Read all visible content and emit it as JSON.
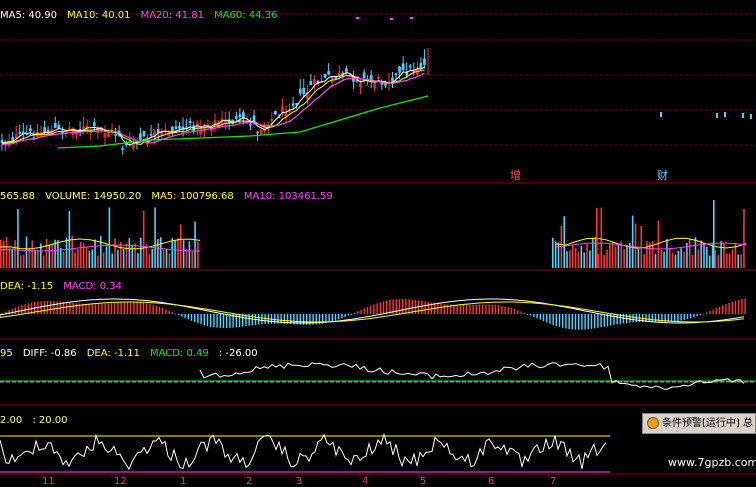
{
  "colors": {
    "background": "#000000",
    "grid": "#8a0000",
    "up": "#ff3333",
    "down": "#4ad3ff",
    "white": "#ffffff",
    "yellow": "#ffff00",
    "magenta": "#ff44ff",
    "green": "#00ee00",
    "label": "#ffff66"
  },
  "price_panel": {
    "ma5": {
      "label": "MA5: 40.90",
      "color": "#ffffff"
    },
    "ma10": {
      "label": "MA10: 40.01",
      "color": "#ffff00"
    },
    "ma20": {
      "label": "MA20: 41.81",
      "color": "#ff44ff"
    },
    "ma60": {
      "label": "MA60: 44.36",
      "color": "#00ee00"
    },
    "marks": {
      "zeng": "增",
      "cai": "财"
    }
  },
  "volume_panel": {
    "prefix": "565.88",
    "volume": "VOLUME: 14950.20",
    "ma5": "MA5: 100796.68",
    "ma10": "MA10: 103461.59"
  },
  "macd_panel": {
    "dea": "DEA: -1.15",
    "macd": "MACD: 0.34"
  },
  "macd2_panel": {
    "prefix": "95",
    "diff": "DIFF: -0.86",
    "dea": "DEA: -1.11",
    "macd": "MACD: 0.49",
    "extra": ": -26.00"
  },
  "osc_panel": {
    "left": "2.00",
    "right": ": 20.00"
  },
  "x_axis": {
    "ticks": [
      "11",
      "12",
      "1",
      "2",
      "3",
      "4",
      "5",
      "6",
      "7"
    ]
  },
  "alert": {
    "text": "条件预警[运行中] 总"
  },
  "watermark": {
    "text": "www.7gpzb.com"
  }
}
